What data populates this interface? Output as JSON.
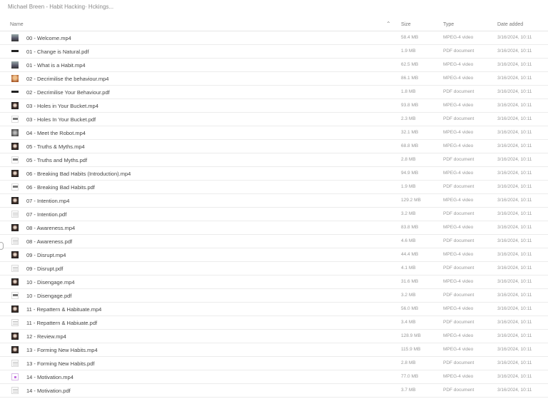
{
  "breadcrumb": "Michael Breen - Habit Hacking· Hckings...",
  "columns": {
    "name": "Name",
    "size": "Size",
    "type": "Type",
    "date": "Date added",
    "sort_icon": "chevron-up-icon"
  },
  "files": [
    {
      "name": "00 - Welcome.mp4",
      "size": "58.4 MB",
      "type": "MPEG-4 video",
      "date": "3/16/2024, 10:11",
      "icon": "ic-video-gray"
    },
    {
      "name": "01 - Change is Natural.pdf",
      "size": "1.9 MB",
      "type": "PDF document",
      "date": "3/16/2024, 10:11",
      "icon": "ic-pdf-bar"
    },
    {
      "name": "01 - What is a Habit.mp4",
      "size": "62.5 MB",
      "type": "MPEG-4 video",
      "date": "3/16/2024, 10:11",
      "icon": "ic-video-gray"
    },
    {
      "name": "02 - Decrimilise the behaviour.mp4",
      "size": "86.1 MB",
      "type": "MPEG-4 video",
      "date": "3/16/2024, 10:11",
      "icon": "ic-video-orange"
    },
    {
      "name": "02 - Decrimilise Your Behaviour.pdf",
      "size": "1.8 MB",
      "type": "PDF document",
      "date": "3/16/2024, 10:11",
      "icon": "ic-pdf-bar"
    },
    {
      "name": "03 - Holes in Your Bucket.mp4",
      "size": "93.8 MB",
      "type": "MPEG-4 video",
      "date": "3/16/2024, 10:11",
      "icon": "ic-video-face"
    },
    {
      "name": "03 - Holes In Your Bucket.pdf",
      "size": "2.3 MB",
      "type": "PDF document",
      "date": "3/16/2024, 10:11",
      "icon": "ic-pdf-grid"
    },
    {
      "name": "04 - Meet the Robot.mp4",
      "size": "32.1 MB",
      "type": "MPEG-4 video",
      "date": "3/16/2024, 10:11",
      "icon": "ic-video-robot"
    },
    {
      "name": "05 - Truths & Myths.mp4",
      "size": "68.8 MB",
      "type": "MPEG-4 video",
      "date": "3/16/2024, 10:11",
      "icon": "ic-video-face"
    },
    {
      "name": "05 - Truths and Myths.pdf",
      "size": "2.8 MB",
      "type": "PDF document",
      "date": "3/16/2024, 10:11",
      "icon": "ic-pdf-grid"
    },
    {
      "name": "06 - Breaking Bad Habits (Introduction).mp4",
      "size": "94.9 MB",
      "type": "MPEG-4 video",
      "date": "3/16/2024, 10:11",
      "icon": "ic-video-face"
    },
    {
      "name": "06 - Breaking Bad Habits.pdf",
      "size": "1.9 MB",
      "type": "PDF document",
      "date": "3/16/2024, 10:11",
      "icon": "ic-pdf-grid"
    },
    {
      "name": "07 - Intention.mp4",
      "size": "129.2 MB",
      "type": "MPEG-4 video",
      "date": "3/16/2024, 10:11",
      "icon": "ic-video-face"
    },
    {
      "name": "07 - Intention.pdf",
      "size": "3.2 MB",
      "type": "PDF document",
      "date": "3/16/2024, 10:11",
      "icon": "ic-pdf-lines"
    },
    {
      "name": "08 - Awareness.mp4",
      "size": "83.8 MB",
      "type": "MPEG-4 video",
      "date": "3/16/2024, 10:11",
      "icon": "ic-video-face"
    },
    {
      "name": "08 - Awareness.pdf",
      "size": "4.6 MB",
      "type": "PDF document",
      "date": "3/16/2024, 10:11",
      "icon": "ic-pdf-lines"
    },
    {
      "name": "09 - Disrupt.mp4",
      "size": "44.4 MB",
      "type": "MPEG-4 video",
      "date": "3/16/2024, 10:11",
      "icon": "ic-video-face"
    },
    {
      "name": "09 - Disrupt.pdf",
      "size": "4.1 MB",
      "type": "PDF document",
      "date": "3/16/2024, 10:11",
      "icon": "ic-pdf-lines"
    },
    {
      "name": "10 - Disengage.mp4",
      "size": "31.6 MB",
      "type": "MPEG-4 video",
      "date": "3/16/2024, 10:11",
      "icon": "ic-video-face"
    },
    {
      "name": "10 - Disengage.pdf",
      "size": "3.2 MB",
      "type": "PDF document",
      "date": "3/16/2024, 10:11",
      "icon": "ic-pdf-grid"
    },
    {
      "name": "11 - Repattern & Habituate.mp4",
      "size": "56.0 MB",
      "type": "MPEG-4 video",
      "date": "3/16/2024, 10:11",
      "icon": "ic-video-face"
    },
    {
      "name": "11 - Repattern & Habiuate.pdf",
      "size": "3.4 MB",
      "type": "PDF document",
      "date": "3/16/2024, 10:11",
      "icon": "ic-pdf-lines"
    },
    {
      "name": "12 - Review.mp4",
      "size": "128.9 MB",
      "type": "MPEG-4 video",
      "date": "3/16/2024, 10:11",
      "icon": "ic-video-face"
    },
    {
      "name": "13 - Forming New Habits.mp4",
      "size": "115.9 MB",
      "type": "MPEG-4 video",
      "date": "3/16/2024, 10:11",
      "icon": "ic-video-face"
    },
    {
      "name": "13 - Forming New Habits.pdf",
      "size": "2.8 MB",
      "type": "PDF document",
      "date": "3/16/2024, 10:11",
      "icon": "ic-pdf-lines"
    },
    {
      "name": "14 - Motivation.mp4",
      "size": "77.0 MB",
      "type": "MPEG-4 video",
      "date": "3/16/2024, 10:11",
      "icon": "ic-video-pink"
    },
    {
      "name": "14 - Motivation.pdf",
      "size": "3.7 MB",
      "type": "PDF document",
      "date": "3/16/2024, 10:11",
      "icon": "ic-pdf-lines"
    }
  ]
}
